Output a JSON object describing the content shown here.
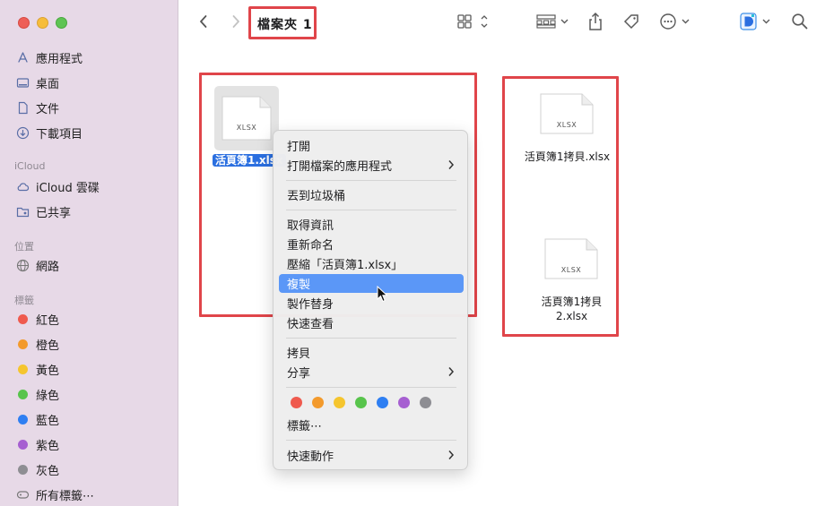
{
  "window": {
    "title": "檔案夾 1"
  },
  "sidebar": {
    "favorites": [
      {
        "label": "應用程式",
        "icon": "apps-icon"
      },
      {
        "label": "桌面",
        "icon": "desktop-icon"
      },
      {
        "label": "文件",
        "icon": "document-icon"
      },
      {
        "label": "下載項目",
        "icon": "download-icon"
      }
    ],
    "icloud_title": "iCloud",
    "icloud": [
      {
        "label": "iCloud 雲碟",
        "icon": "cloud-icon"
      },
      {
        "label": "已共享",
        "icon": "shared-folder-icon"
      }
    ],
    "locations_title": "位置",
    "locations": [
      {
        "label": "網路",
        "icon": "network-icon"
      }
    ],
    "tags_title": "標籤",
    "tags": [
      {
        "label": "紅色",
        "color": "#ef5a4e"
      },
      {
        "label": "橙色",
        "color": "#f39a2c"
      },
      {
        "label": "黃色",
        "color": "#f5c52e"
      },
      {
        "label": "綠色",
        "color": "#58c44c"
      },
      {
        "label": "藍色",
        "color": "#2f7ff2"
      },
      {
        "label": "紫色",
        "color": "#a65fd1"
      },
      {
        "label": "灰色",
        "color": "#8e8e93"
      }
    ],
    "all_tags": "所有標籤⋯"
  },
  "files": [
    {
      "name": "活頁簿1.xlsx",
      "type": "XLSX",
      "selected": true
    },
    {
      "name": "活頁簿1拷貝.xlsx",
      "type": "XLSX"
    },
    {
      "name_line1": "活頁簿1拷貝",
      "name_line2": "2.xlsx",
      "type": "XLSX"
    }
  ],
  "context_menu": {
    "items": [
      {
        "label": "打開"
      },
      {
        "label": "打開檔案的應用程式",
        "submenu": true
      },
      {
        "label": "丟到垃圾桶"
      },
      {
        "label": "取得資訊"
      },
      {
        "label": "重新命名"
      },
      {
        "label": "壓縮「活頁簿1.xlsx」"
      },
      {
        "label": "複製",
        "highlighted": true
      },
      {
        "label": "製作替身"
      },
      {
        "label": "快速查看"
      },
      {
        "label": "拷貝"
      },
      {
        "label": "分享",
        "submenu": true
      },
      {
        "label": "標籤⋯"
      },
      {
        "label": "快速動作",
        "submenu": true
      }
    ],
    "tag_colors": [
      "#ef5a4e",
      "#f39a2c",
      "#f5c52e",
      "#58c44c",
      "#2f7ff2",
      "#a65fd1",
      "#8e8e93"
    ]
  },
  "colors": {
    "accent": "#5b97f7",
    "annotation": "#e0454a",
    "sidebar_bg": "#e7d9e7"
  }
}
